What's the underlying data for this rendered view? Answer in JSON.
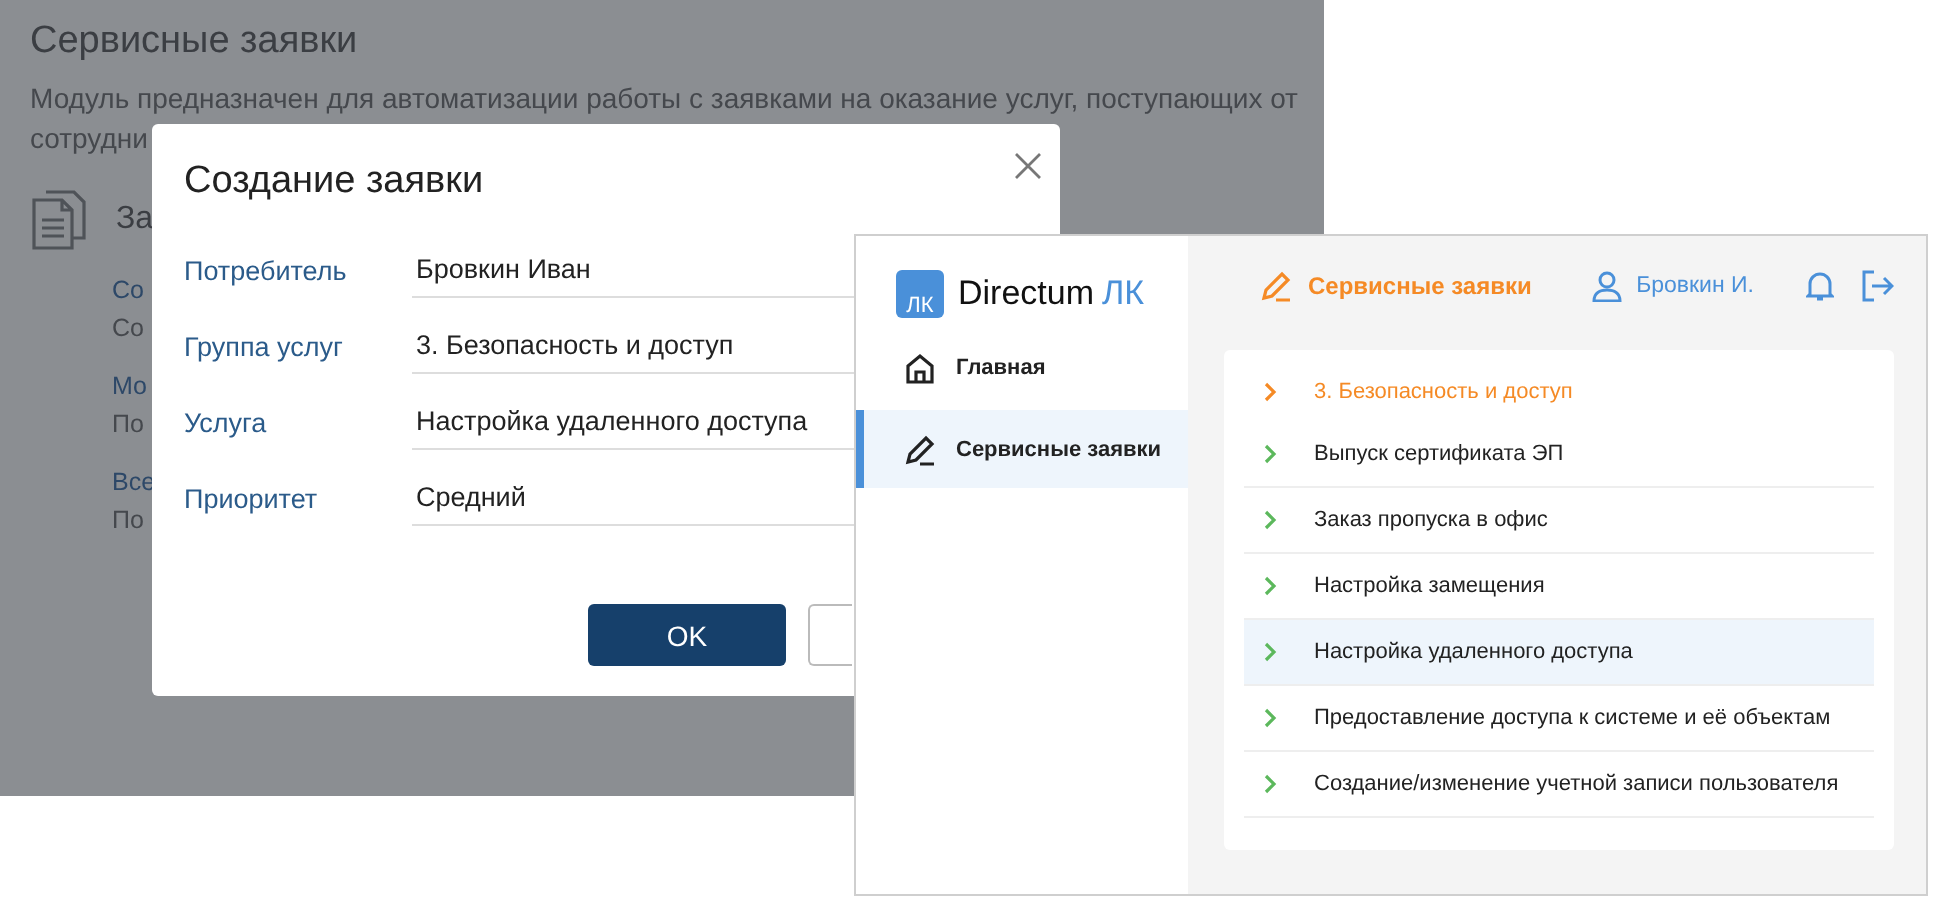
{
  "background_page": {
    "title": "Сервисные заявки",
    "description_lines": [
      "Модуль предназначен для автоматизации работы с заявками на оказание услуг, поступающих от",
      "сотрудни"
    ],
    "section_heading": "За",
    "items": [
      {
        "title": "Со",
        "subtitle": "Со"
      },
      {
        "title": "Мо",
        "subtitle": "По"
      },
      {
        "title": "Все",
        "subtitle": "По"
      }
    ]
  },
  "dialog": {
    "title": "Создание заявки",
    "fields": [
      {
        "label": "Потребитель",
        "value": "Бровкин Иван"
      },
      {
        "label": "Группа услуг",
        "value": "3. Безопасность и доступ"
      },
      {
        "label": "Услуга",
        "value": "Настройка удаленного доступа"
      },
      {
        "label": "Приоритет",
        "value": "Средний"
      }
    ],
    "buttons": [
      {
        "kind": "primary",
        "label": "OK"
      },
      {
        "kind": "secondary"
      }
    ]
  },
  "app_window": {
    "logo": {
      "badge": "ЛК",
      "name": "Directum",
      "suffix": "ЛК"
    },
    "header": {
      "section": "Сервисные заявки",
      "user": "Бровкин И."
    },
    "sidebar": {
      "items": [
        {
          "kind": "home",
          "label": "Главная",
          "selected": false
        },
        {
          "kind": "pencil",
          "label": "Сервисные заявки",
          "selected": true
        }
      ]
    },
    "list": {
      "group": "3. Безопасность и доступ",
      "items": [
        {
          "label": "Выпуск сертификата ЭП",
          "selected": false
        },
        {
          "label": "Заказ пропуска в офис",
          "selected": false
        },
        {
          "label": "Настройка замещения",
          "selected": false
        },
        {
          "label": "Настройка удаленного доступа",
          "selected": true
        },
        {
          "label": "Предоставление доступа к системе и её объектам",
          "selected": false
        },
        {
          "label": "Создание/изменение учетной записи пользователя",
          "selected": false
        }
      ]
    }
  }
}
